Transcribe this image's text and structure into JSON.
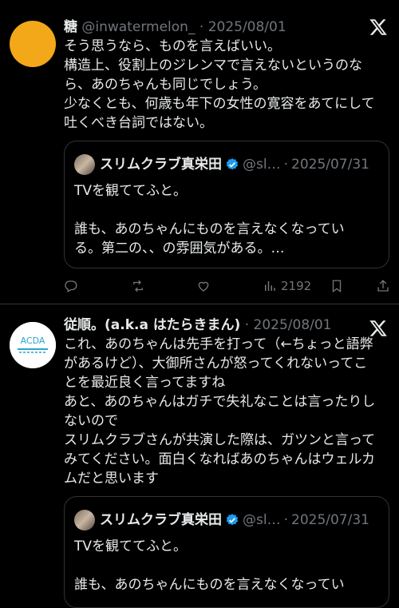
{
  "tweets": [
    {
      "display_name": "糖",
      "handle": "@inwatermelon_",
      "separator": "·",
      "date": "2025/08/01",
      "body_lines": [
        "そう思うなら、ものを言えばいい。",
        "構造上、役割上のジレンマで言えないというのな",
        "ら、あのちゃんも同じでしょう。",
        "少なくとも、何歳も年下の女性の寛容をあてにして",
        "吐くべき台詞ではない。"
      ],
      "quote": {
        "display_name": "スリムクラブ真栄田",
        "handle": "@sl…",
        "separator": "·",
        "date": "2025/07/31",
        "body_lines": [
          "TVを観ててふと。",
          "",
          "誰も、あのちゃんにものを言えなくなってい",
          "る。第二の、、の雰囲気がある。…"
        ]
      },
      "actions": {
        "views": "2192"
      },
      "avatar_color": "#f2a818"
    },
    {
      "display_name": "従順。(a.k.a はたらきまん)",
      "separator": "·",
      "date": "2025/08/01",
      "body_lines": [
        "これ、あのちゃんは先手を打って（←ちょっと語弊",
        "があるけど）、大御所さんが怒ってくれないってこ",
        "とを最近良く言ってますね",
        "あと、あのちゃんはガチで失礼なことは言ったりし",
        "ないので",
        "スリムクラブさんが共演した際は、ガツンと言って",
        "みてください。面白くなればあのちゃんはウェルカ",
        "ムだと思います"
      ],
      "quote": {
        "display_name": "スリムクラブ真栄田",
        "handle": "@sl…",
        "separator": "·",
        "date": "2025/07/31",
        "body_lines": [
          "TVを観ててふと。",
          "",
          "誰も、あのちゃんにものを言えなくなってい"
        ]
      }
    }
  ],
  "colors": {
    "background": "#000000",
    "text": "#e7e9ea",
    "muted": "#71767b",
    "border": "#2f3336",
    "verified": "#1d9bf0"
  },
  "icons": [
    "x-logo-icon",
    "reply-icon",
    "repost-icon",
    "like-icon",
    "views-icon",
    "bookmark-icon",
    "share-icon",
    "verified-badge-icon"
  ]
}
